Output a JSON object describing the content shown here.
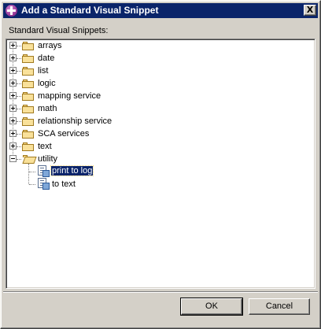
{
  "window": {
    "title": "Add a Standard Visual Snippet",
    "close_glyph": "X"
  },
  "tree": {
    "label": "Standard Visual Snippets:",
    "folders": [
      {
        "label": "arrays",
        "expanded": false
      },
      {
        "label": "date",
        "expanded": false
      },
      {
        "label": "list",
        "expanded": false
      },
      {
        "label": "logic",
        "expanded": false
      },
      {
        "label": "mapping service",
        "expanded": false
      },
      {
        "label": "math",
        "expanded": false
      },
      {
        "label": "relationship service",
        "expanded": false
      },
      {
        "label": "SCA services",
        "expanded": false
      },
      {
        "label": "text",
        "expanded": false
      },
      {
        "label": "utility",
        "expanded": true
      }
    ],
    "utility_children": [
      {
        "label": "print to log",
        "selected": true
      },
      {
        "label": "to text",
        "selected": false
      }
    ]
  },
  "buttons": {
    "ok": "OK",
    "cancel": "Cancel"
  },
  "icons": {
    "title_icon": "purple-plus-icon",
    "folder_icon": "folder-icon",
    "snippet_icon": "visual-snippet-icon"
  },
  "colors": {
    "titlebar": "#0a246a",
    "selection": "#0a246a",
    "dialog_bg": "#d4d0c8"
  }
}
